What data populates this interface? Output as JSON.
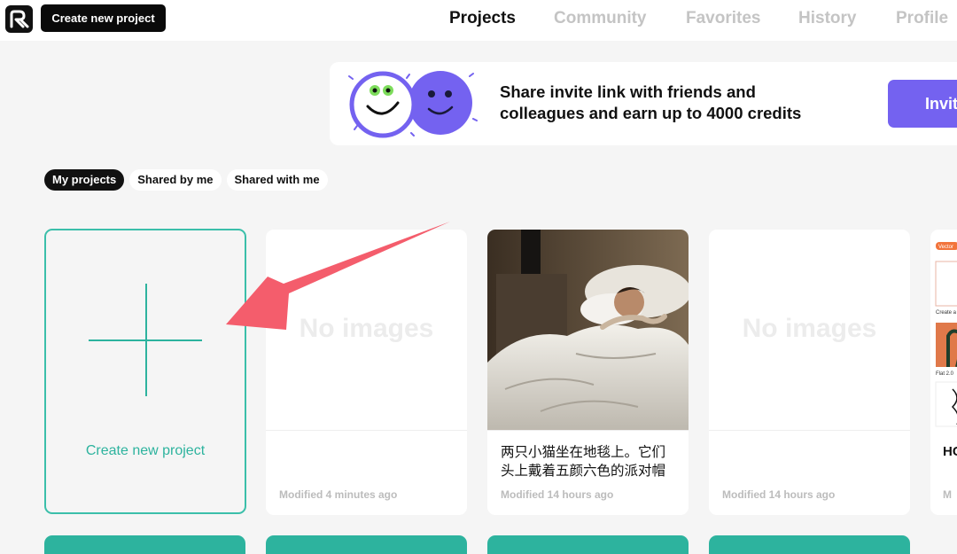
{
  "header": {
    "create_button": "Create new project",
    "nav": [
      {
        "label": "Projects",
        "active": true
      },
      {
        "label": "Community",
        "active": false
      },
      {
        "label": "Favorites",
        "active": false
      },
      {
        "label": "History",
        "active": false
      },
      {
        "label": "Profile",
        "active": false
      }
    ]
  },
  "banner": {
    "text_line1": "Share invite link with friends and",
    "text_line2": "colleagues and earn up to 4000 credits",
    "invite_button": "Invite"
  },
  "filters": [
    {
      "label": "My projects",
      "active": true
    },
    {
      "label": "Shared by me",
      "active": false
    },
    {
      "label": "Shared with me",
      "active": false
    }
  ],
  "create_card": {
    "label": "Create new project"
  },
  "projects": [
    {
      "image": "none",
      "placeholder": "No images",
      "caption": "",
      "modified": "Modified 4 minutes ago"
    },
    {
      "image": "photo-man-sleeping",
      "caption": "两只小猫坐在地毯上。它们头上戴着五颜六色的派对帽子，旁边有一个礼物盒子",
      "modified": "Modified 14 hours ago"
    },
    {
      "image": "none",
      "placeholder": "No images",
      "caption": "",
      "modified": "Modified 14 hours ago"
    }
  ],
  "partial_card": {
    "title": "HC",
    "modified": "M",
    "tag": "Vector",
    "thumb_caption_1": "Create a",
    "thumb_caption_2": "Flat 2.0"
  },
  "colors": {
    "accent": "#2db39e",
    "invite": "#7462f0",
    "annotation_arrow": "#f45d6c"
  }
}
